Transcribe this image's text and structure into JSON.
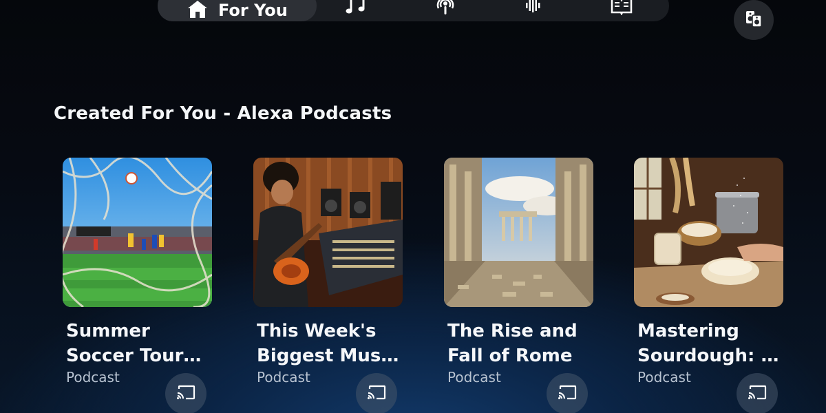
{
  "nav": {
    "active_label": "For You",
    "icons": [
      "home-icon",
      "music-note-icon",
      "podcast-icon",
      "audio-wave-icon",
      "book-icon",
      "speakers-icon"
    ]
  },
  "section": {
    "title": "Created For You - Alexa Podcasts"
  },
  "cards": [
    {
      "title_line1": "Summer",
      "title_line2": "Soccer Tournament",
      "subtitle": "Podcast"
    },
    {
      "title_line1": "This Week's",
      "title_line2": "Biggest Music News",
      "subtitle": "Podcast"
    },
    {
      "title_line1": "The Rise and",
      "title_line2": "Fall of Rome",
      "subtitle": "Podcast"
    },
    {
      "title_line1": "Mastering",
      "title_line2": "Sourdough: Tips",
      "subtitle": "Podcast"
    }
  ],
  "colors": {
    "nav_bg": "#1a1d22",
    "nav_active": "#2d3036",
    "accent_blue": "#123a6b"
  }
}
